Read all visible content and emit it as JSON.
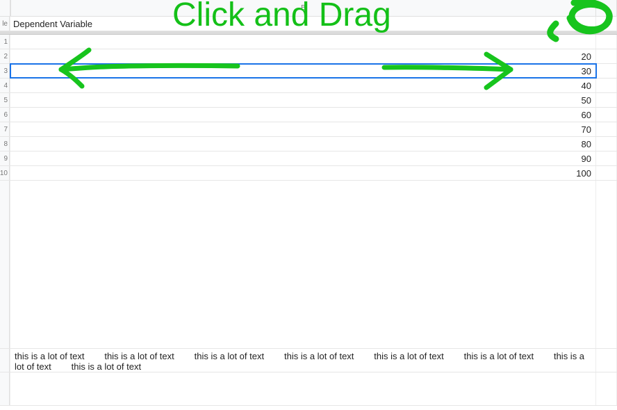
{
  "columns": {
    "A_label": "",
    "B_label": "B",
    "C_label": ""
  },
  "header_row": {
    "A_fragment": "le",
    "B_text": "Dependent Variable"
  },
  "rows": [
    {
      "n": "1",
      "val": ""
    },
    {
      "n": "2",
      "val": "20"
    },
    {
      "n": "3",
      "val": "30"
    },
    {
      "n": "4",
      "val": "40"
    },
    {
      "n": "5",
      "val": "50"
    },
    {
      "n": "6",
      "val": "60"
    },
    {
      "n": "7",
      "val": "70"
    },
    {
      "n": "8",
      "val": "80"
    },
    {
      "n": "9",
      "val": "90"
    },
    {
      "n": "10",
      "val": "100"
    }
  ],
  "long_text_row": "this is a lot of text        this is a lot of text        this is a lot of text        this is a lot of text        this is a lot of text        this is a lot of text        this is a lot of text        this is a lot of text",
  "selected_row_index": 2,
  "annotation": {
    "text": "Click and Drag"
  }
}
